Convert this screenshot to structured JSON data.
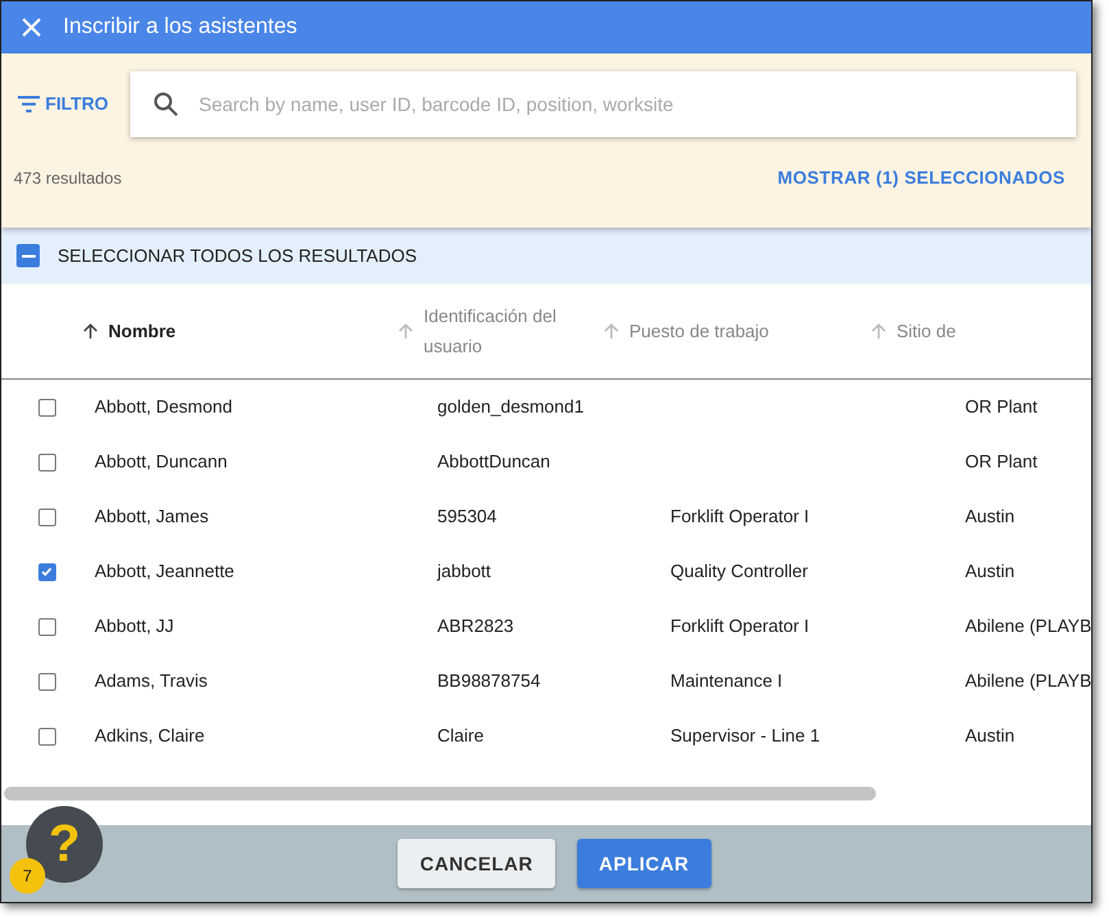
{
  "dialog": {
    "title": "Inscribir a los asistentes"
  },
  "filter": {
    "label": "FILTRO"
  },
  "search": {
    "placeholder": "Search by name, user ID, barcode ID, position, worksite"
  },
  "result_count": "473 resultados",
  "show_selected": "MOSTRAR (1) SELECCIONADOS",
  "select_all": {
    "label": "SELECCIONAR TODOS LOS RESULTADOS",
    "indeterminate": true
  },
  "table": {
    "columns": [
      {
        "label": "Nombre",
        "sorted": true
      },
      {
        "label": "Identificación del usuario",
        "sorted": false
      },
      {
        "label": "Puesto de trabajo",
        "sorted": false
      },
      {
        "label": "Sitio de",
        "sorted": false
      }
    ],
    "rows": [
      {
        "checked": false,
        "cells": [
          "Abbott, Desmond",
          "golden_desmond1",
          "",
          "OR Plant"
        ]
      },
      {
        "checked": false,
        "cells": [
          "Abbott, Duncann",
          "AbbottDuncan",
          "",
          "OR Plant"
        ]
      },
      {
        "checked": false,
        "cells": [
          "Abbott, James",
          "595304",
          "Forklift Operator I",
          "Austin"
        ]
      },
      {
        "checked": true,
        "cells": [
          "Abbott, Jeannette",
          "jabbott",
          "Quality Controller",
          "Austin"
        ]
      },
      {
        "checked": false,
        "cells": [
          "Abbott, JJ",
          "ABR2823",
          "Forklift Operator I",
          "Abilene (PLAYB"
        ]
      },
      {
        "checked": false,
        "cells": [
          "Adams, Travis",
          "BB98878754",
          "Maintenance I",
          "Abilene (PLAYB"
        ]
      },
      {
        "checked": false,
        "cells": [
          "Adkins, Claire",
          "Claire",
          "Supervisor - Line 1",
          "Austin"
        ]
      }
    ]
  },
  "buttons": [
    {
      "label": "CANCELAR",
      "kind": "secondary"
    },
    {
      "label": "APLICAR",
      "kind": "primary"
    }
  ],
  "help": {
    "icon": "?",
    "badge": "7"
  }
}
